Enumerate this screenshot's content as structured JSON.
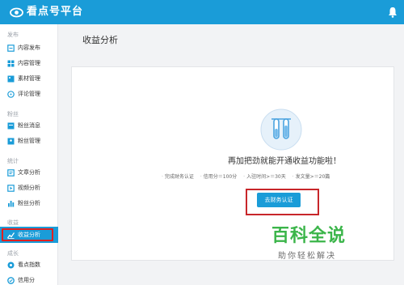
{
  "app": {
    "brand": "看点号平台"
  },
  "sidebar": {
    "sections": [
      {
        "label": "发布"
      },
      {
        "label": "粉丝"
      },
      {
        "label": "统计"
      },
      {
        "label": "收益"
      },
      {
        "label": "成长"
      }
    ],
    "items": [
      {
        "label": "内容发布",
        "icon": "edit-document-icon"
      },
      {
        "label": "内容管理",
        "icon": "grid-icon"
      },
      {
        "label": "素材管理",
        "icon": "image-icon"
      },
      {
        "label": "评论管理",
        "icon": "comment-icon"
      },
      {
        "label": "粉丝消息",
        "icon": "message-icon"
      },
      {
        "label": "粉丝管理",
        "icon": "user-icon"
      },
      {
        "label": "文章分析",
        "icon": "article-icon"
      },
      {
        "label": "视频分析",
        "icon": "video-icon"
      },
      {
        "label": "粉丝分析",
        "icon": "bar-chart-icon"
      },
      {
        "label": "收益分析",
        "icon": "line-chart-icon",
        "active": true
      },
      {
        "label": "看点指数",
        "icon": "index-icon"
      },
      {
        "label": "信用分",
        "icon": "credit-icon"
      }
    ]
  },
  "main": {
    "title": "收益分析",
    "headline": "再加把劲就能开通收益功能啦！",
    "requirements": [
      "完成财务认证",
      "信用分＝100分",
      "入驻时间>＝30天",
      "发文量>＝20篇"
    ],
    "cta_label": "去财务认证"
  },
  "watermark": {
    "main": "百科全说",
    "sub": "助你轻松解决"
  },
  "colors": {
    "accent": "#1a9cd8",
    "highlight": "#e02020",
    "watermark": "#3bb54a"
  }
}
